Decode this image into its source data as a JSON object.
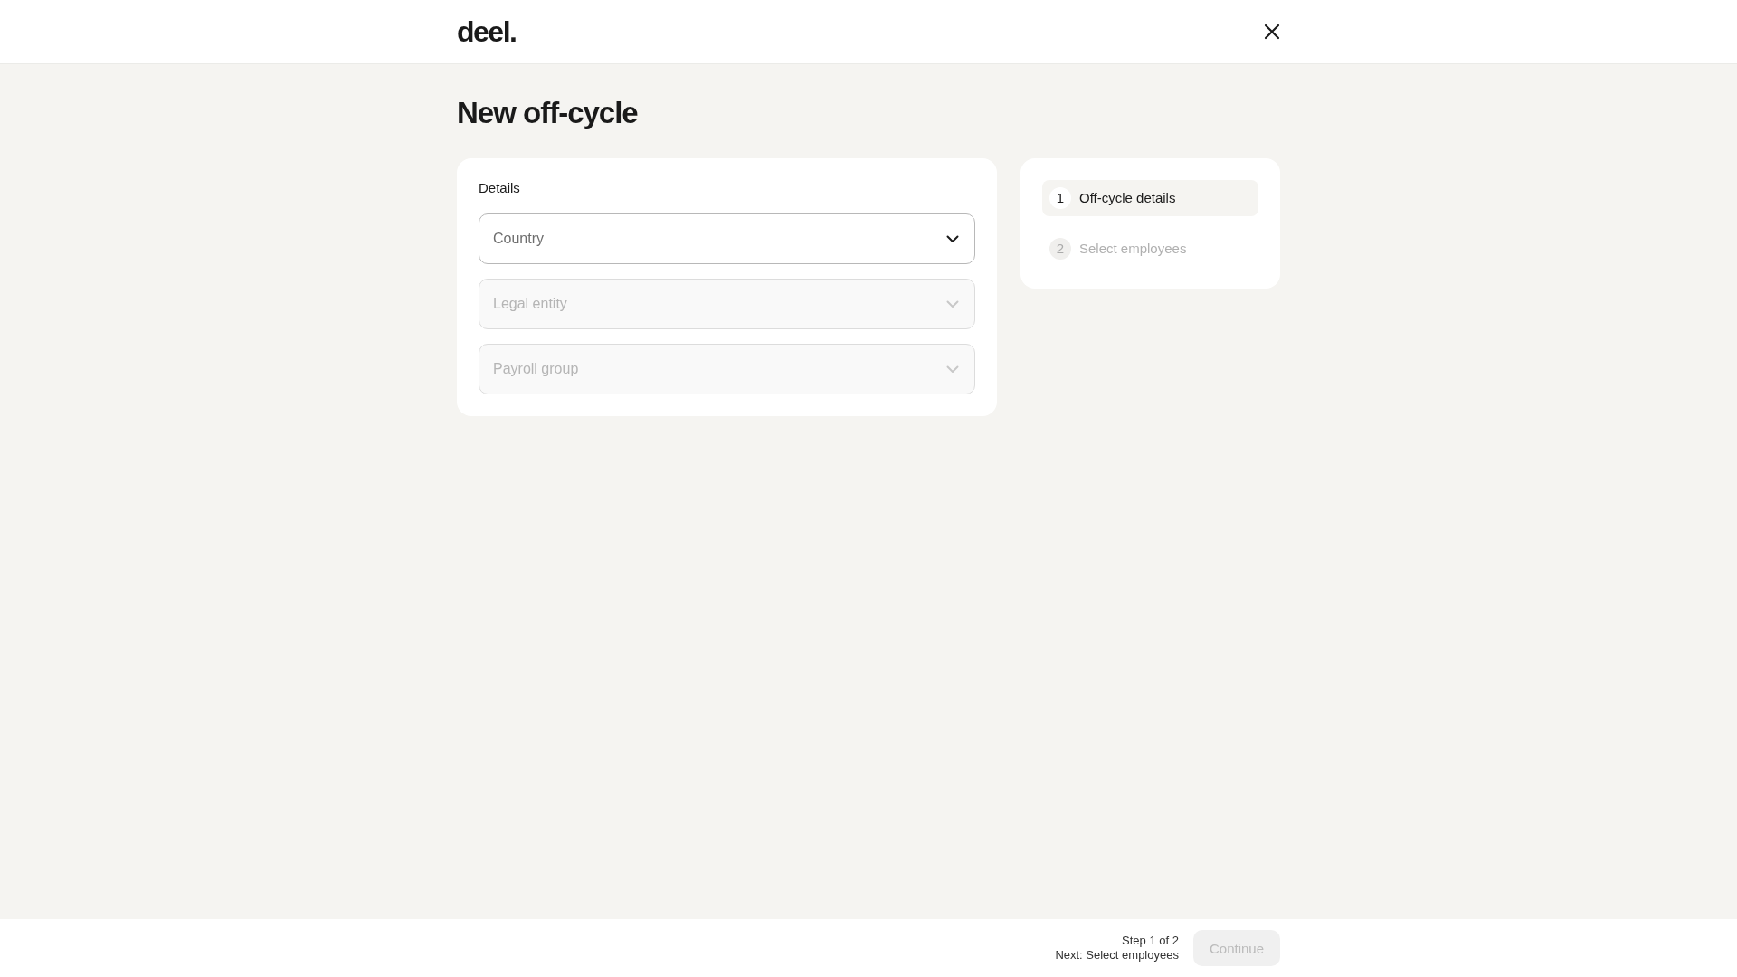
{
  "header": {
    "logo": "deel."
  },
  "page_title": "New off-cycle",
  "details": {
    "heading": "Details",
    "fields": [
      {
        "placeholder": "Country",
        "disabled": false
      },
      {
        "placeholder": "Legal entity",
        "disabled": true
      },
      {
        "placeholder": "Payroll group",
        "disabled": true
      }
    ]
  },
  "steps": [
    {
      "number": "1",
      "label": "Off-cycle details",
      "selected": true
    },
    {
      "number": "2",
      "label": "Select employees",
      "selected": false
    }
  ],
  "footer": {
    "step_text": "Step 1 of 2",
    "next_text": "Next: Select employees",
    "continue": {
      "label": "Continue",
      "disabled": true
    }
  }
}
